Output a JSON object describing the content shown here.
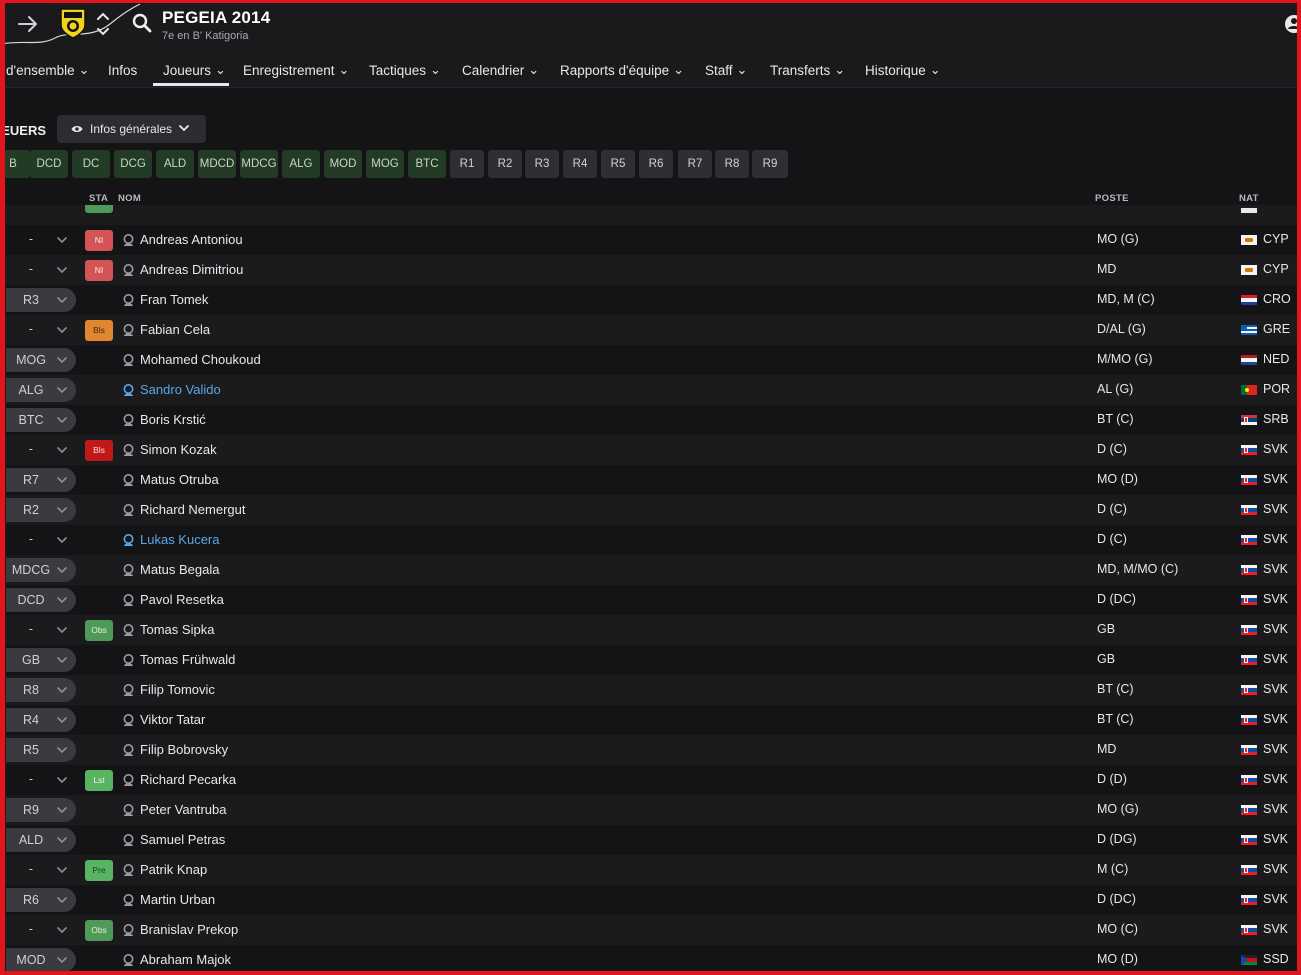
{
  "club": {
    "name": "PEGEIA 2014",
    "subtitle": "7e en B' Katigoria"
  },
  "nav": {
    "items": [
      {
        "label": "d'ensemble",
        "chevron": true
      },
      {
        "label": "Infos",
        "chevron": false
      },
      {
        "label": "Joueurs",
        "chevron": true,
        "active": true
      },
      {
        "label": "Enregistrement",
        "chevron": true
      },
      {
        "label": "Tactiques",
        "chevron": true
      },
      {
        "label": "Calendrier",
        "chevron": true
      },
      {
        "label": "Rapports d'équipe",
        "chevron": true
      },
      {
        "label": "Staff",
        "chevron": true
      },
      {
        "label": "Transferts",
        "chevron": true
      },
      {
        "label": "Historique",
        "chevron": true
      }
    ]
  },
  "section": {
    "title": "JEUERS",
    "view_label": "Infos générales"
  },
  "position_filters": [
    {
      "label": "B",
      "style": "green"
    },
    {
      "label": "DCD",
      "style": "green"
    },
    {
      "label": "DC",
      "style": "green"
    },
    {
      "label": "DCG",
      "style": "green"
    },
    {
      "label": "ALD",
      "style": "green"
    },
    {
      "label": "MDCD",
      "style": "green"
    },
    {
      "label": "MDCG",
      "style": "green"
    },
    {
      "label": "ALG",
      "style": "green"
    },
    {
      "label": "MOD",
      "style": "green"
    },
    {
      "label": "MOG",
      "style": "green"
    },
    {
      "label": "BTC",
      "style": "green"
    },
    {
      "label": "R1",
      "style": "dark"
    },
    {
      "label": "R2",
      "style": "dark"
    },
    {
      "label": "R3",
      "style": "dark"
    },
    {
      "label": "R4",
      "style": "dark"
    },
    {
      "label": "R5",
      "style": "dark"
    },
    {
      "label": "R6",
      "style": "dark"
    },
    {
      "label": "R7",
      "style": "dark"
    },
    {
      "label": "R8",
      "style": "dark"
    },
    {
      "label": "R9",
      "style": "dark"
    }
  ],
  "table": {
    "headers": {
      "status": "STA",
      "name": "NOM",
      "position": "POSTE",
      "nationality": "NAT"
    },
    "rows": [
      {
        "selection": "-",
        "status": "NI",
        "status_style": "NI",
        "name": "Andreas Antoniou",
        "link": false,
        "position": "MO (G)",
        "nat": "CYP",
        "flag": "CYP"
      },
      {
        "selection": "-",
        "status": "NI",
        "status_style": "NI",
        "name": "Andreas Dimitriou",
        "link": false,
        "position": "MD",
        "nat": "CYP",
        "flag": "CYP"
      },
      {
        "selection": "R3",
        "status": "",
        "status_style": "",
        "name": "Fran Tomek",
        "link": false,
        "position": "MD, M (C)",
        "nat": "CRO",
        "flag": "CRO"
      },
      {
        "selection": "-",
        "status": "Bls",
        "status_style": "BlsO",
        "name": "Fabian Cela",
        "link": false,
        "position": "D/AL (G)",
        "nat": "GRE",
        "flag": "GRE"
      },
      {
        "selection": "MOG",
        "status": "",
        "status_style": "",
        "name": "Mohamed Choukoud",
        "link": false,
        "position": "M/MO (G)",
        "nat": "NED",
        "flag": "NED"
      },
      {
        "selection": "ALG",
        "status": "",
        "status_style": "",
        "name": "Sandro Valido",
        "link": true,
        "position": "AL (G)",
        "nat": "POR",
        "flag": "POR"
      },
      {
        "selection": "BTC",
        "status": "",
        "status_style": "",
        "name": "Boris Krstić",
        "link": false,
        "position": "BT (C)",
        "nat": "SRB",
        "flag": "SRB"
      },
      {
        "selection": "-",
        "status": "Bls",
        "status_style": "BlsR",
        "name": "Simon Kozak",
        "link": false,
        "position": "D (C)",
        "nat": "SVK",
        "flag": "SVK"
      },
      {
        "selection": "R7",
        "status": "",
        "status_style": "",
        "name": "Matus Otruba",
        "link": false,
        "position": "MO (D)",
        "nat": "SVK",
        "flag": "SVK"
      },
      {
        "selection": "R2",
        "status": "",
        "status_style": "",
        "name": "Richard Nemergut",
        "link": false,
        "position": "D (C)",
        "nat": "SVK",
        "flag": "SVK"
      },
      {
        "selection": "-",
        "status": "",
        "status_style": "",
        "name": "Lukas Kucera",
        "link": true,
        "position": "D (C)",
        "nat": "SVK",
        "flag": "SVK"
      },
      {
        "selection": "MDCG",
        "status": "",
        "status_style": "",
        "name": "Matus Begala",
        "link": false,
        "position": "MD, M/MO (C)",
        "nat": "SVK",
        "flag": "SVK"
      },
      {
        "selection": "DCD",
        "status": "",
        "status_style": "",
        "name": "Pavol Resetka",
        "link": false,
        "position": "D (DC)",
        "nat": "SVK",
        "flag": "SVK"
      },
      {
        "selection": "-",
        "status": "Obs",
        "status_style": "Obs",
        "name": "Tomas Sipka",
        "link": false,
        "position": "GB",
        "nat": "SVK",
        "flag": "SVK"
      },
      {
        "selection": "GB",
        "status": "",
        "status_style": "",
        "name": "Tomas Frühwald",
        "link": false,
        "position": "GB",
        "nat": "SVK",
        "flag": "SVK"
      },
      {
        "selection": "R8",
        "status": "",
        "status_style": "",
        "name": "Filip Tomovic",
        "link": false,
        "position": "BT (C)",
        "nat": "SVK",
        "flag": "SVK"
      },
      {
        "selection": "R4",
        "status": "",
        "status_style": "",
        "name": "Viktor Tatar",
        "link": false,
        "position": "BT (C)",
        "nat": "SVK",
        "flag": "SVK"
      },
      {
        "selection": "R5",
        "status": "",
        "status_style": "",
        "name": "Filip Bobrovsky",
        "link": false,
        "position": "MD",
        "nat": "SVK",
        "flag": "SVK"
      },
      {
        "selection": "-",
        "status": "Lst",
        "status_style": "Lst",
        "name": "Richard Pecarka",
        "link": false,
        "position": "D (D)",
        "nat": "SVK",
        "flag": "SVK"
      },
      {
        "selection": "R9",
        "status": "",
        "status_style": "",
        "name": "Peter Vantruba",
        "link": false,
        "position": "MO (G)",
        "nat": "SVK",
        "flag": "SVK"
      },
      {
        "selection": "ALD",
        "status": "",
        "status_style": "",
        "name": "Samuel Petras",
        "link": false,
        "position": "D (DG)",
        "nat": "SVK",
        "flag": "SVK"
      },
      {
        "selection": "-",
        "status": "Pre",
        "status_style": "Pre",
        "name": "Patrik Knap",
        "link": false,
        "position": "M (C)",
        "nat": "SVK",
        "flag": "SVK"
      },
      {
        "selection": "R6",
        "status": "",
        "status_style": "",
        "name": "Martin Urban",
        "link": false,
        "position": "D (DC)",
        "nat": "SVK",
        "flag": "SVK"
      },
      {
        "selection": "-",
        "status": "Obs",
        "status_style": "Obs",
        "name": "Branislav Prekop",
        "link": false,
        "position": "MO (C)",
        "nat": "SVK",
        "flag": "SVK"
      },
      {
        "selection": "MOD",
        "status": "",
        "status_style": "",
        "name": "Abraham Majok",
        "link": false,
        "position": "MO (D)",
        "nat": "SSD",
        "flag": "SSD"
      }
    ]
  },
  "colors": {
    "background": "#141416",
    "row_alt": "#1b1b1e",
    "link": "#5aa7e6",
    "frame": "#e0161c",
    "filter_green": "#233a25"
  }
}
